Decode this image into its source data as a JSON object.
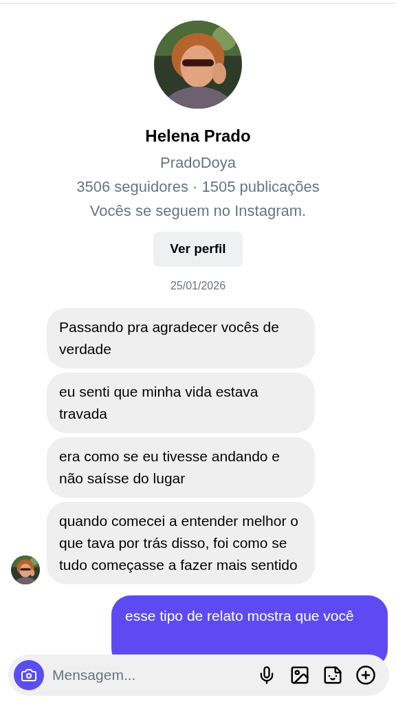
{
  "profile": {
    "name": "Helena Prado",
    "username": "PradoDoya",
    "stats": "3506 seguidores · 1505 publicações",
    "mutual": "Vocês se seguem no Instagram.",
    "button": "Ver perfil"
  },
  "date": "25/01/2026",
  "messages": [
    {
      "kind": "incoming",
      "text": "Passando pra agradecer vocês de verdade",
      "avatar": false
    },
    {
      "kind": "incoming",
      "text": "eu senti que minha vida estava travada",
      "avatar": false
    },
    {
      "kind": "incoming",
      "text": "era como se eu tivesse andando e não saísse do lugar",
      "avatar": false
    },
    {
      "kind": "incoming",
      "text": "quando comecei a entender melhor o que tava por trás disso, foi como se tudo começasse a fazer mais sentido",
      "avatar": true
    },
    {
      "kind": "outgoing",
      "text": "esse tipo de relato mostra que você"
    }
  ],
  "composer": {
    "placeholder": "Mensagem..."
  }
}
